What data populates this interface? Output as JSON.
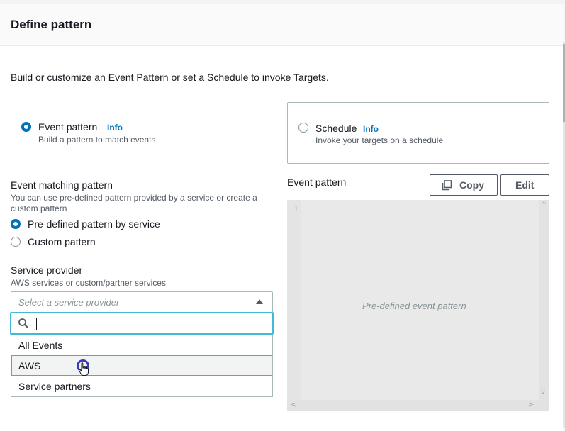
{
  "panel": {
    "title": "Define pattern",
    "description": "Build or customize an Event Pattern or set a Schedule to invoke Targets."
  },
  "pattern_type": {
    "event": {
      "label": "Event pattern",
      "info": "Info",
      "sub": "Build a pattern to match events",
      "selected": true
    },
    "schedule": {
      "label": "Schedule",
      "info": "Info",
      "sub": "Invoke your targets on a schedule",
      "selected": false
    }
  },
  "matching": {
    "title": "Event matching pattern",
    "hint_line1": "You can use pre-defined pattern provided by a service or create a",
    "hint_line2": "custom pattern",
    "options": [
      {
        "label": "Pre-defined pattern by service",
        "selected": true
      },
      {
        "label": "Custom pattern",
        "selected": false
      }
    ]
  },
  "service_provider": {
    "label": "Service provider",
    "hint": "AWS services or custom/partner services",
    "placeholder": "Select a service provider",
    "search_value": "",
    "options": [
      "All Events",
      "AWS",
      "Service partners"
    ],
    "hovered_option": "AWS"
  },
  "event_pattern": {
    "title": "Event pattern",
    "copy_label": "Copy",
    "edit_label": "Edit",
    "line_number": "1",
    "placeholder": "Pre-defined event pattern"
  },
  "colors": {
    "accent": "#0073bb",
    "focus": "#44b9d6",
    "text": "#16191f",
    "muted": "#545b64"
  },
  "icons": [
    "search-icon",
    "copy-icon",
    "caret-up-icon",
    "hand-cursor-icon"
  ]
}
